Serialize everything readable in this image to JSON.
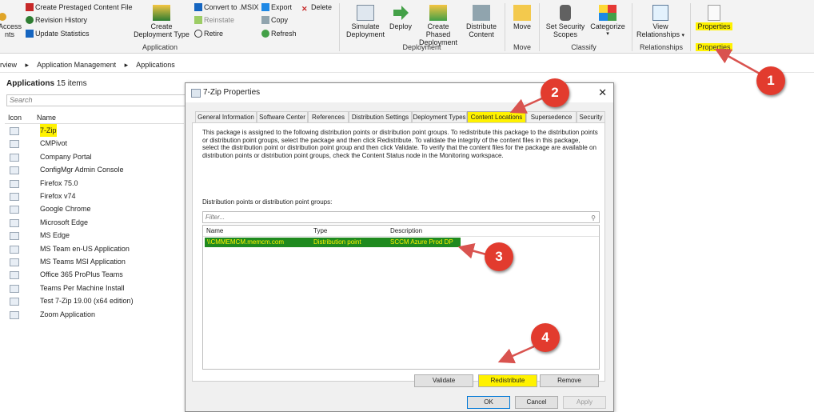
{
  "ribbon": {
    "access_label_1": "Access",
    "access_label_2": "nts",
    "small_buttons": {
      "create_prestaged": "Create Prestaged Content File",
      "revision_history": "Revision History",
      "update_statistics": "Update Statistics",
      "convert_msix": "Convert to .MSIX",
      "export": "Export",
      "delete": "Delete",
      "reinstate": "Reinstate",
      "copy": "Copy",
      "retire": "Retire",
      "refresh": "Refresh"
    },
    "create_deployment_type_1": "Create",
    "create_deployment_type_2": "Deployment Type",
    "simulate_1": "Simulate",
    "simulate_2": "Deployment",
    "deploy": "Deploy",
    "create_phased_1": "Create Phased",
    "create_phased_2": "Deployment",
    "distribute_1": "Distribute",
    "distribute_2": "Content",
    "move": "Move",
    "set_security_1": "Set Security",
    "set_security_2": "Scopes",
    "categorize": "Categorize",
    "view_relationships_1": "View",
    "view_relationships_2": "Relationships",
    "properties": "Properties",
    "groups": {
      "application": "Application",
      "deployment": "Deployment",
      "move": "Move",
      "classify": "Classify",
      "relationships": "Relationships",
      "properties": "Properties"
    }
  },
  "breadcrumb": {
    "item1": "rview",
    "item2": "Application Management",
    "item3": "Applications",
    "sep": "▸"
  },
  "list": {
    "title": "Applications",
    "count": "15 items",
    "search_placeholder": "Search",
    "col_icon": "Icon",
    "col_name": "Name",
    "items": [
      "7-Zip",
      "CMPivot",
      "Company Portal",
      "ConfigMgr Admin Console",
      "Firefox 75.0",
      "Firefox v74",
      "Google Chrome",
      "Microsoft Edge",
      "MS Edge",
      "MS Team en-US Application",
      "MS Teams MSI Application",
      "Office 365 ProPlus Teams",
      "Teams Per Machine Install",
      "Test 7-Zip 19.00 (x64 edition)",
      "Zoom Application"
    ]
  },
  "dialog": {
    "title": "7-Zip Properties",
    "close": "✕",
    "tabs": [
      "General Information",
      "Software Center",
      "References",
      "Distribution Settings",
      "Deployment Types",
      "Content Locations",
      "Supersedence",
      "Security"
    ],
    "active_tab": "Content Locations",
    "description_lines": [
      "This package is assigned to the following distribution points or distribution point groups. To redistribute this package to the distribution points",
      "or distribution point groups, select the package and then click Redistribute. To validate the integrity of the content files in this package,",
      "select the distribution point or distribution point group and then click Validate. To verify that the content files for the package are available on",
      "distribution points or distribution point groups, check the Content Status node in the Monitoring workspace."
    ],
    "dp_label": "Distribution points or distribution point groups:",
    "filter_placeholder": "Filter...",
    "grid_headers": [
      "Name",
      "Type",
      "Description"
    ],
    "grid_row": {
      "name": "\\\\CMMEMCM.memcm.com",
      "type": "Distribution point",
      "description": "SCCM Azure Prod DP"
    },
    "buttons": {
      "validate": "Validate",
      "redistribute": "Redistribute",
      "remove": "Remove",
      "ok": "OK",
      "cancel": "Cancel",
      "apply": "Apply"
    }
  },
  "callouts": [
    "1",
    "2",
    "3",
    "4"
  ],
  "colors": {
    "highlight": "#fff200",
    "selected_row": "#1f8a1f",
    "callout": "#e23b2e",
    "arrow": "#d9534f"
  }
}
